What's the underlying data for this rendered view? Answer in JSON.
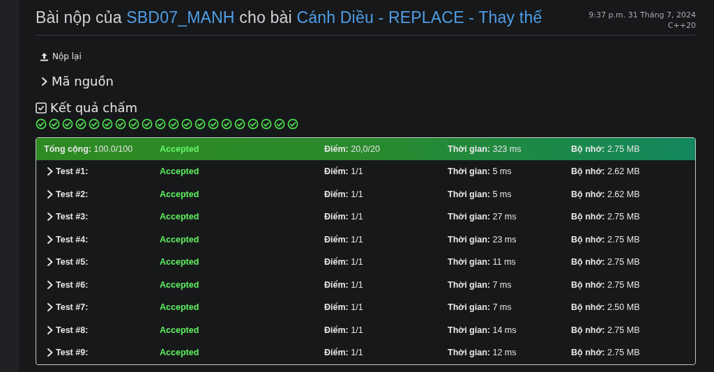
{
  "header": {
    "title_prefix": "Bài nộp của",
    "user": "SBD07_MANH",
    "title_middle": "cho bài",
    "problem": "Cánh Diều - REPLACE - Thay thế",
    "date": "9:37 p.m. 31 Tháng 7, 2024",
    "language": "C++20"
  },
  "resubmit": {
    "label": "Nộp lại"
  },
  "source": {
    "label": "Mã nguồn",
    "expanded": false
  },
  "results": {
    "label": "Kết quả chấm",
    "cases": [
      {
        "kind": "accepted"
      },
      {
        "kind": "accepted"
      },
      {
        "kind": "accepted"
      },
      {
        "kind": "accepted"
      },
      {
        "kind": "accepted"
      },
      {
        "kind": "accepted"
      },
      {
        "kind": "accepted"
      },
      {
        "kind": "accepted"
      },
      {
        "kind": "accepted"
      },
      {
        "kind": "accepted"
      },
      {
        "kind": "accepted"
      },
      {
        "kind": "accepted"
      },
      {
        "kind": "accepted"
      },
      {
        "kind": "accepted"
      },
      {
        "kind": "accepted"
      },
      {
        "kind": "accepted"
      },
      {
        "kind": "accepted"
      },
      {
        "kind": "accepted"
      },
      {
        "kind": "accepted"
      },
      {
        "kind": "accepted"
      }
    ],
    "summary": {
      "total": "**Tổng cộng:** 100.0/100",
      "status": "Accepted",
      "points": "**Điểm:** 20,0/20",
      "time": "**Thời gian:** 323 ms",
      "memory": "**Bộ nhớ:** 2.75 MB"
    },
    "tests": [
      {
        "label": "Test #1:",
        "expanded": false,
        "status": "Accepted",
        "points": "**Điểm:** 1/1",
        "time": "**Thời gian:** 5 ms",
        "memory": "**Bộ nhớ:** 2.62 MB"
      },
      {
        "label": "Test #2:",
        "expanded": false,
        "status": "Accepted",
        "points": "**Điểm:** 1/1",
        "time": "**Thời gian:** 5 ms",
        "memory": "**Bộ nhớ:** 2.62 MB"
      },
      {
        "label": "Test #3:",
        "expanded": false,
        "status": "Accepted",
        "points": "**Điểm:** 1/1",
        "time": "**Thời gian:** 27 ms",
        "memory": "**Bộ nhớ:** 2.75 MB"
      },
      {
        "label": "Test #4:",
        "expanded": false,
        "status": "Accepted",
        "points": "**Điểm:** 1/1",
        "time": "**Thời gian:** 23 ms",
        "memory": "**Bộ nhớ:** 2.75 MB"
      },
      {
        "label": "Test #5:",
        "expanded": false,
        "status": "Accepted",
        "points": "**Điểm:** 1/1",
        "time": "**Thời gian:** 11 ms",
        "memory": "**Bộ nhớ:** 2.75 MB"
      },
      {
        "label": "Test #6:",
        "expanded": false,
        "status": "Accepted",
        "points": "**Điểm:** 1/1",
        "time": "**Thời gian:** 7 ms",
        "memory": "**Bộ nhớ:** 2.75 MB"
      },
      {
        "label": "Test #7:",
        "expanded": false,
        "status": "Accepted",
        "points": "**Điểm:** 1/1",
        "time": "**Thời gian:** 7 ms",
        "memory": "**Bộ nhớ:** 2.50 MB"
      },
      {
        "label": "Test #8:",
        "expanded": false,
        "status": "Accepted",
        "points": "**Điểm:** 1/1",
        "time": "**Thời gian:** 14 ms",
        "memory": "**Bộ nhớ:** 2.75 MB"
      },
      {
        "label": "Test #9:",
        "expanded": false,
        "status": "Accepted",
        "points": "**Điểm:** 1/1",
        "time": "**Thời gian:** 12 ms",
        "memory": "**Bộ nhớ:** 2.75 MB"
      }
    ]
  }
}
